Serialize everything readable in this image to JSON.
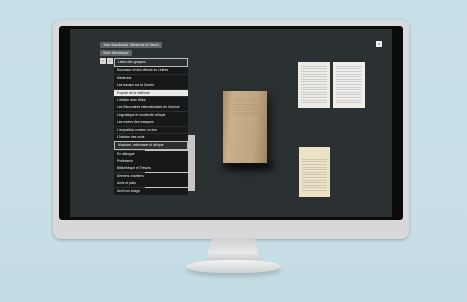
{
  "breadcrumbs": [
    "Jean Starobinski. Médecine et Savoir",
    "Série thématique"
  ],
  "nav": {
    "prev": "‹",
    "next": "›"
  },
  "menu": [
    {
      "label": "Listes des groupes",
      "state": "outlined"
    },
    {
      "label": "Nouveaux et des débuts en Lettres",
      "state": "normal"
    },
    {
      "label": "Médecine",
      "state": "normal"
    },
    {
      "label": "Les travaux sur la Guerre",
      "state": "normal"
    },
    {
      "label": "Exposé de la méthode",
      "state": "active"
    },
    {
      "label": "L'édition avec Skira",
      "state": "normal"
    },
    {
      "label": "Les Rencontres internationales de Genève",
      "state": "normal"
    },
    {
      "label": "Linguistique et modernité critique",
      "state": "normal"
    },
    {
      "label": "Les envers des masques",
      "state": "normal"
    },
    {
      "label": "L'exposition comme un don",
      "state": "normal"
    },
    {
      "label": "L'histoire des mots",
      "state": "normal"
    },
    {
      "label": "Musicien, mélomane et critique",
      "state": "outlined"
    },
    {
      "label": "En dialogue",
      "state": "normal"
    },
    {
      "label": "Professeur",
      "state": "normal"
    },
    {
      "label": "Bibliothèque et Trésors",
      "state": "normal"
    },
    {
      "label": "Derniers chantiers",
      "state": "normal"
    },
    {
      "label": "Amis et pairs",
      "state": "normal"
    },
    {
      "label": "Archi sur image",
      "state": "normal"
    }
  ],
  "close": "×"
}
